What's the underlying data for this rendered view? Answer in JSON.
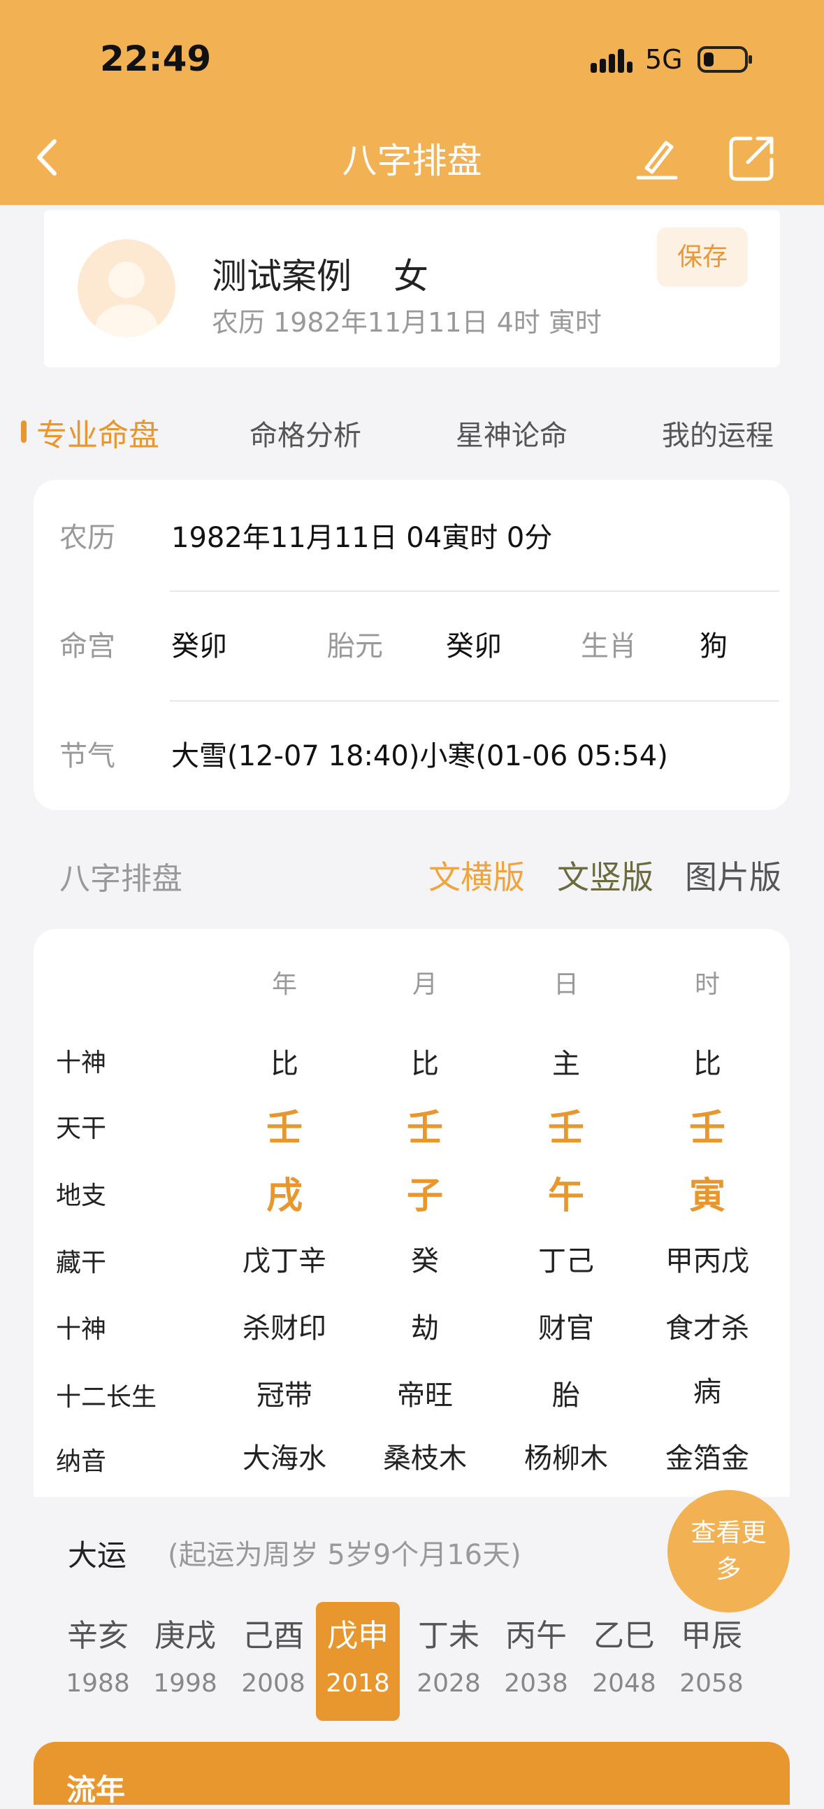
{
  "status_bar": {
    "time": "22:49",
    "network": "5G"
  },
  "nav": {
    "title": "八字排盘"
  },
  "profile": {
    "name": "测试案例",
    "gender": "女",
    "date": "农历 1982年11月11日 4时 寅时",
    "save_label": "保存"
  },
  "tabs": [
    "专业命盘",
    "命格分析",
    "星神论命",
    "我的运程"
  ],
  "info": {
    "lunar_label": "农历",
    "lunar_value": "1982年11月11日 04寅时 0分",
    "minggong_label": "命宫",
    "minggong_value": "癸卯",
    "taiyuan_label": "胎元",
    "taiyuan_value": "癸卯",
    "shengxiao_label": "生肖",
    "shengxiao_value": "狗",
    "jieqi_label": "节气",
    "jieqi_value": "大雪(12-07 18:40)小寒(01-06 05:54)"
  },
  "section": {
    "title": "八字排盘",
    "views": [
      "文横版",
      "文竖版",
      "图片版"
    ]
  },
  "pillars": {
    "headers": [
      "年",
      "月",
      "日",
      "时"
    ],
    "rows": [
      {
        "label": "十神",
        "cells": [
          "比",
          "比",
          "主",
          "比"
        ]
      },
      {
        "label": "天干",
        "cells": [
          "壬",
          "壬",
          "壬",
          "壬"
        ]
      },
      {
        "label": "地支",
        "cells": [
          "戌",
          "子",
          "午",
          "寅"
        ]
      },
      {
        "label": "藏干",
        "cells": [
          "戊丁辛",
          "癸",
          "丁己",
          "甲丙戊"
        ]
      },
      {
        "label": "十神",
        "cells": [
          "杀财印",
          "劫",
          "财官",
          "食才杀"
        ]
      },
      {
        "label": "十二长生",
        "cells": [
          "冠带",
          "帝旺",
          "胎",
          "病"
        ]
      },
      {
        "label": "纳音",
        "cells": [
          "大海水",
          "桑枝木",
          "杨柳木",
          "金箔金"
        ]
      }
    ]
  },
  "dayun": {
    "title": "大运",
    "note": "(起运为周岁 5岁9个月16天)",
    "more_label": "查看更多",
    "items": [
      {
        "gz": "辛亥",
        "year": "1988"
      },
      {
        "gz": "庚戌",
        "year": "1998"
      },
      {
        "gz": "己酉",
        "year": "2008"
      },
      {
        "gz": "戊申",
        "year": "2018"
      },
      {
        "gz": "丁未",
        "year": "2028"
      },
      {
        "gz": "丙午",
        "year": "2038"
      },
      {
        "gz": "乙巳",
        "year": "2048"
      },
      {
        "gz": "甲辰",
        "year": "2058"
      }
    ],
    "selected_index": 3
  },
  "liunian": {
    "title": "流年"
  },
  "colors": {
    "header": "#f2b153",
    "accent": "#e8972f",
    "view_mid": "#6b6b3f"
  }
}
